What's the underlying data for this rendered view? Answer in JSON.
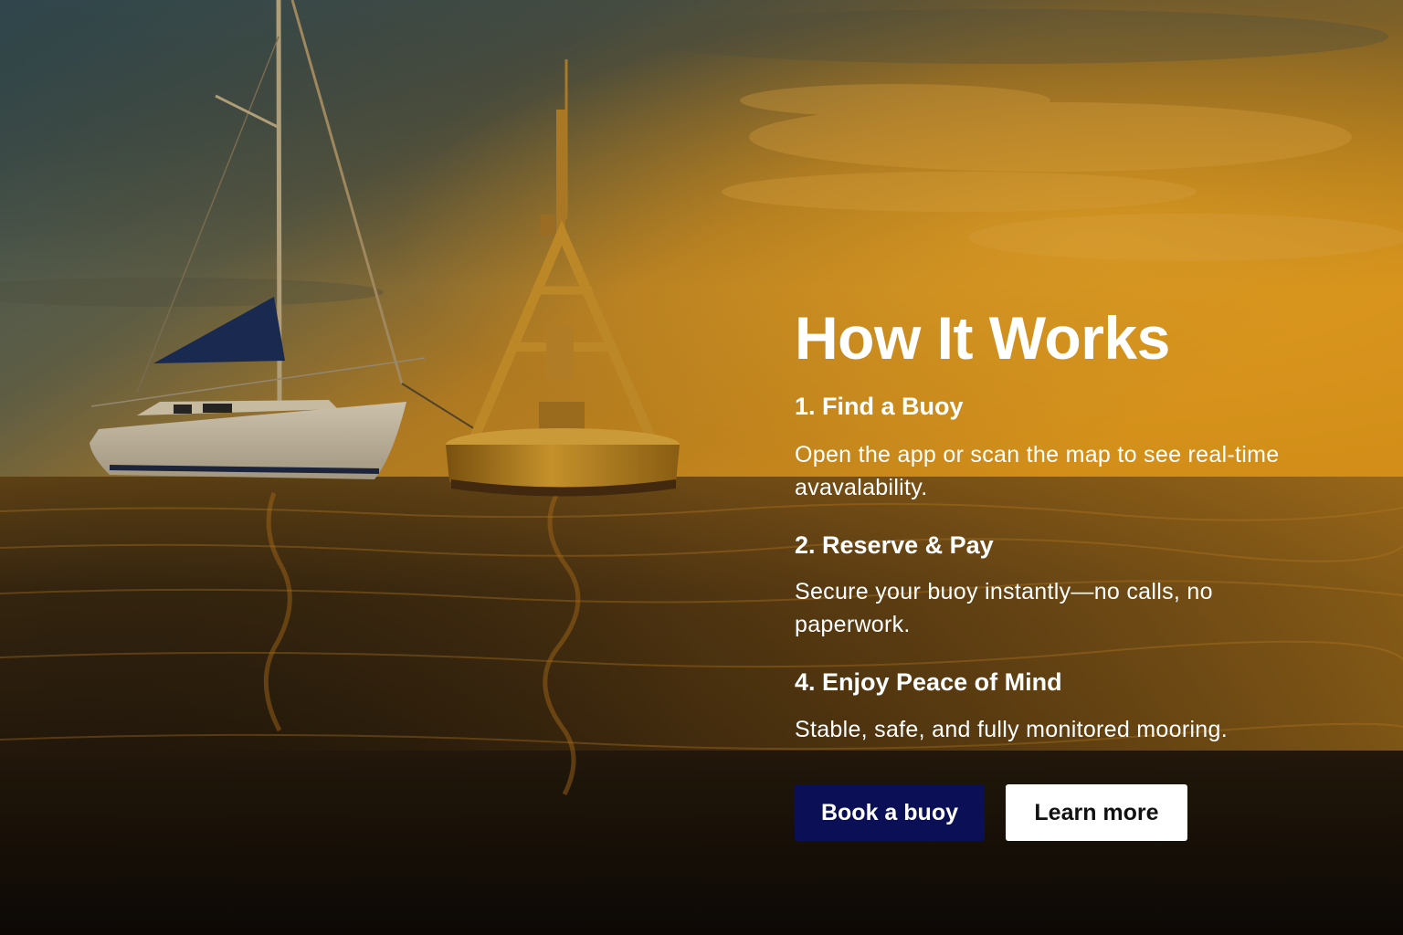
{
  "hero": {
    "title": "How It Works",
    "steps": [
      {
        "heading": "1. Find a Buoy",
        "body": "Open the app or scan the map to see real-time avavalability."
      },
      {
        "heading": "2. Reserve & Pay",
        "body": "Secure your buoy instantly—no calls, no paperwork."
      },
      {
        "heading": "4. Enjoy Peace of Mind",
        "body": "Stable, safe, and fully monitored mooring."
      }
    ],
    "buttons": {
      "primary_label": "Book a buoy",
      "secondary_label": "Learn more"
    }
  },
  "colors": {
    "primary_button": "#0b0f55",
    "secondary_button": "#ffffff",
    "sky_top": "#3f5f66",
    "horizon_glow": "#f0a21c",
    "water_dark": "#0f0a06"
  }
}
